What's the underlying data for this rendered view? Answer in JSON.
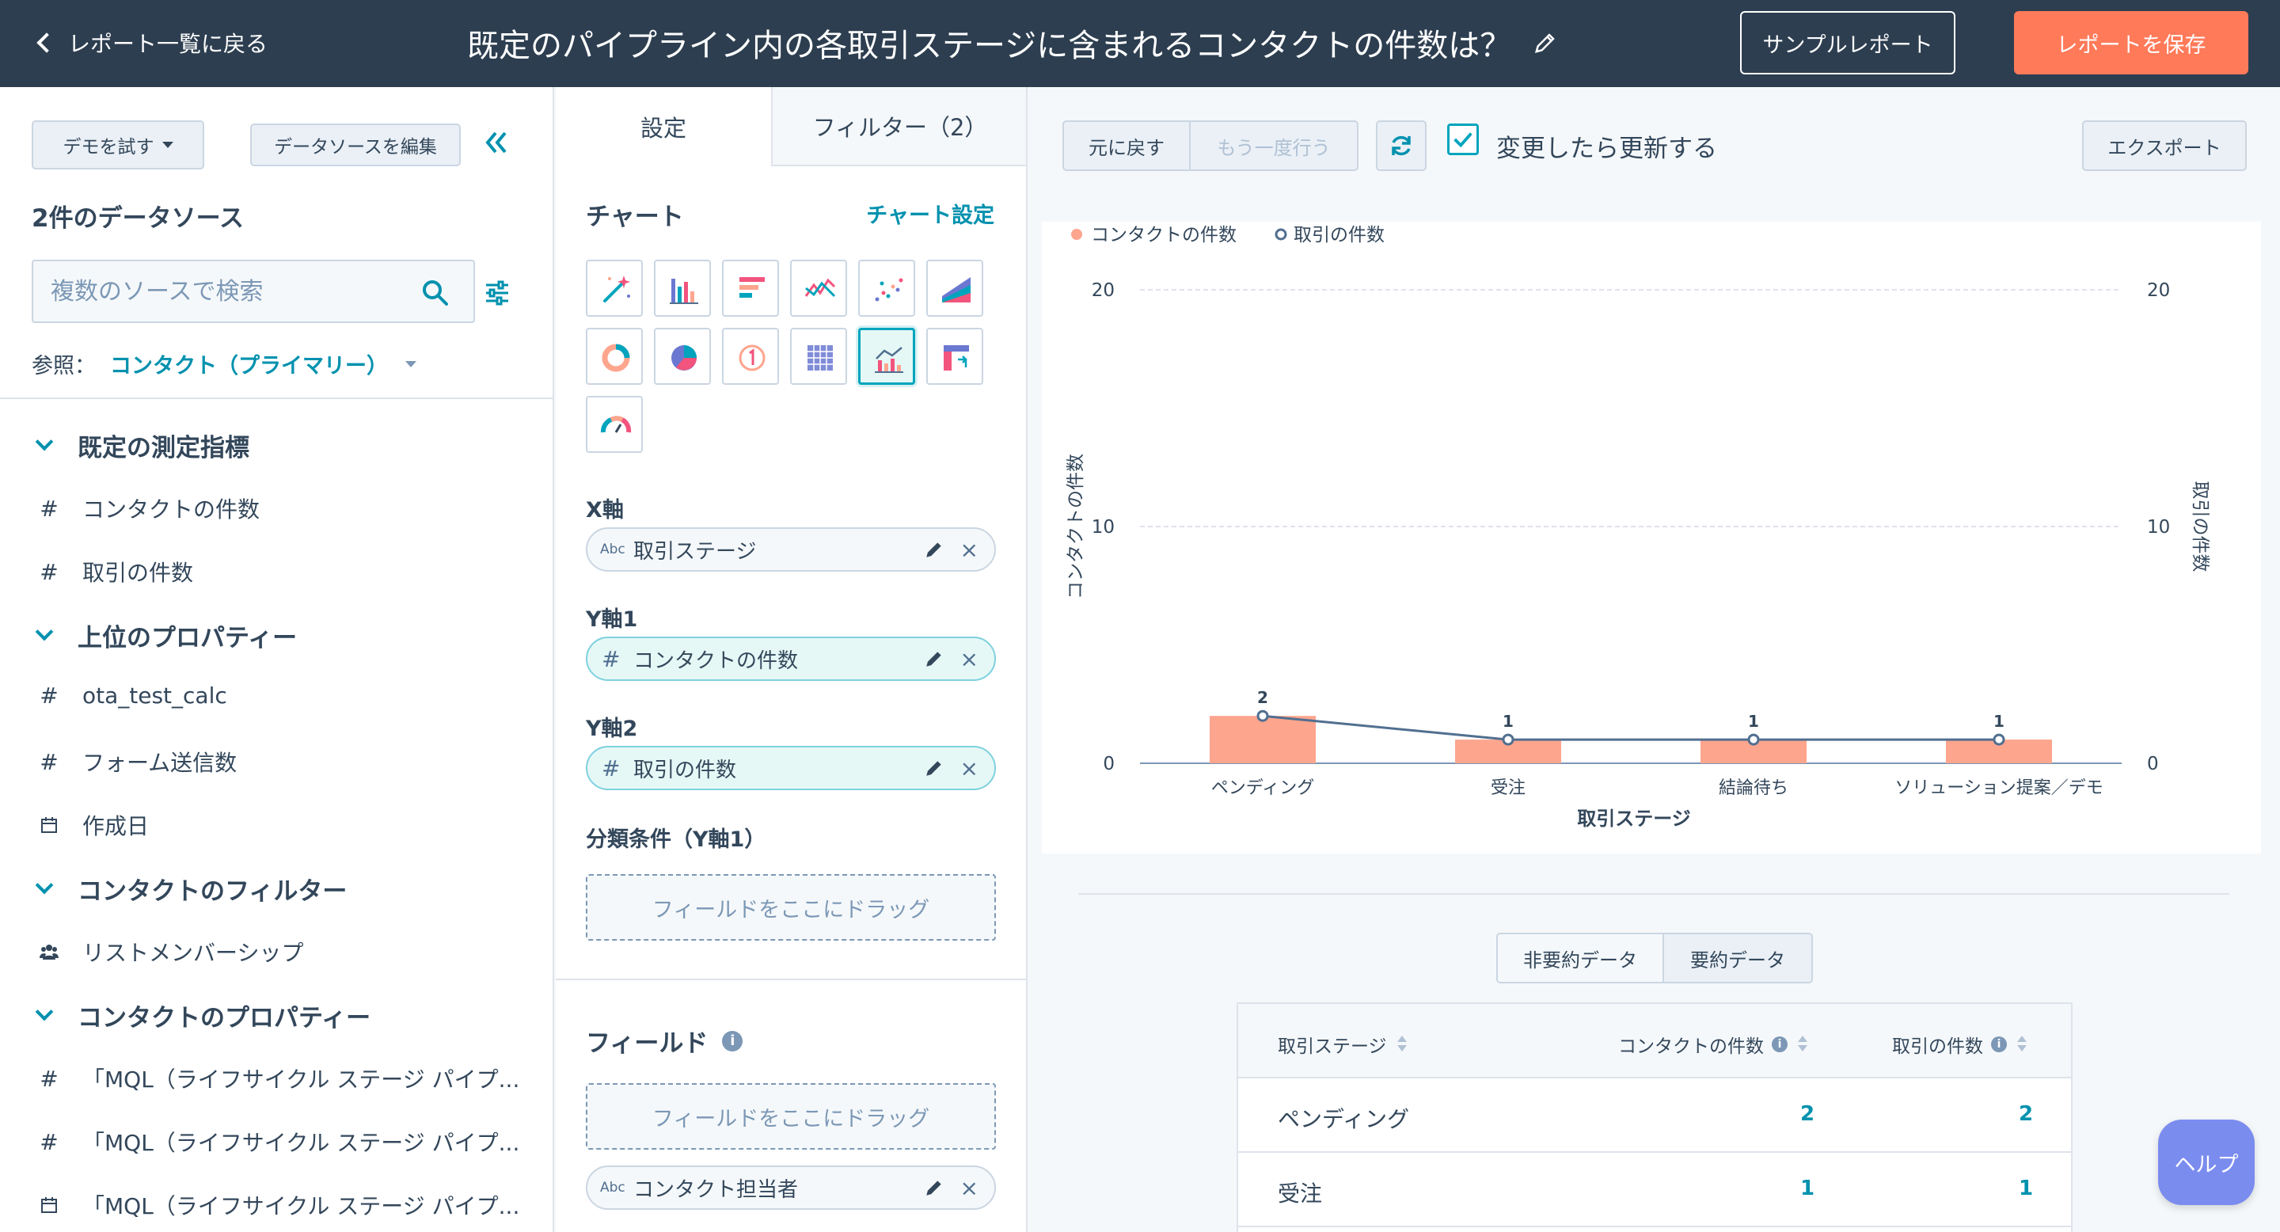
{
  "header": {
    "back_label": "レポート一覧に戻る",
    "title": "既定のパイプライン内の各取引ステージに含まれるコンタクトの件数は？",
    "sample_label": "サンプルレポート",
    "save_label": "レポートを保存"
  },
  "left": {
    "try_demo": "デモを試す",
    "edit_sources": "データソースを編集",
    "sources_title": "2件のデータソース",
    "search_placeholder": "複数のソースで検索",
    "ref_label": "参照：",
    "ref_value": "コンタクト（プライマリー）",
    "sections": [
      {
        "title": "既定の測定指標",
        "items": [
          {
            "icon": "#",
            "label": "コンタクトの件数"
          },
          {
            "icon": "#",
            "label": "取引の件数"
          }
        ]
      },
      {
        "title": "上位のプロパティー",
        "items": [
          {
            "icon": "#",
            "label": "ota_test_calc"
          },
          {
            "icon": "#",
            "label": "フォーム送信数"
          },
          {
            "icon": "calendar",
            "label": "作成日"
          }
        ]
      },
      {
        "title": "コンタクトのフィルター",
        "items": [
          {
            "icon": "people",
            "label": "リストメンバーシップ"
          }
        ]
      },
      {
        "title": "コンタクトのプロパティー",
        "items": [
          {
            "icon": "#",
            "label": "「MQL（ライフサイクル ステージ パイプ..."
          },
          {
            "icon": "#",
            "label": "「MQL（ライフサイクル ステージ パイプ..."
          },
          {
            "icon": "calendar",
            "label": "「MQL（ライフサイクル ステージ パイプ..."
          }
        ]
      }
    ]
  },
  "mid": {
    "tab_settings": "設定",
    "tab_filters": "フィルター（2）",
    "chart_heading": "チャート",
    "chart_settings": "チャート設定",
    "x_axis_label": "X軸",
    "x_axis_value": "取引ステージ",
    "x_axis_prefix": "Abc",
    "y1_label": "Y軸1",
    "y1_value": "コンタクトの件数",
    "y2_label": "Y軸2",
    "y2_value": "取引の件数",
    "breakdown_label": "分類条件（Y軸1）",
    "drop_text": "フィールドをここにドラッグ",
    "fields_heading": "フィールド",
    "field_drop_text": "フィールドをここにドラッグ",
    "field_item": "コンタクト担当者",
    "field_prefix": "Abc"
  },
  "right": {
    "undo": "元に戻す",
    "redo": "もう一度行う",
    "auto_update_label": "変更したら更新する",
    "export": "エクスポート",
    "toggle_unsummarized": "非要約データ",
    "toggle_summarized": "要約データ"
  },
  "chart_data": {
    "type": "bar",
    "categories": [
      "ペンディング",
      "受注",
      "結論待ち",
      "ソリューション提案／デモ"
    ],
    "series": [
      {
        "name": "コンタクトの件数",
        "type": "bar",
        "values": [
          2,
          1,
          1,
          1
        ],
        "color": "#fea58e"
      },
      {
        "name": "取引の件数",
        "type": "line",
        "values": [
          2,
          1,
          1,
          1
        ],
        "color": "#516f90"
      }
    ],
    "xlabel": "取引ステージ",
    "ylabel": "コンタクトの件数",
    "y2label": "取引の件数",
    "ylim": [
      0,
      20
    ],
    "yticks": [
      "0",
      "10",
      "20"
    ],
    "y2ticks": [
      "0",
      "10",
      "20"
    ],
    "legend": "top-left",
    "grid": true
  },
  "table": {
    "headers": [
      "取引ステージ",
      "コンタクトの件数",
      "取引の件数"
    ],
    "rows": [
      {
        "stage": "ペンディング",
        "contacts": "2",
        "deals": "2"
      },
      {
        "stage": "受注",
        "contacts": "1",
        "deals": "1"
      }
    ]
  },
  "help_label": "ヘルプ"
}
